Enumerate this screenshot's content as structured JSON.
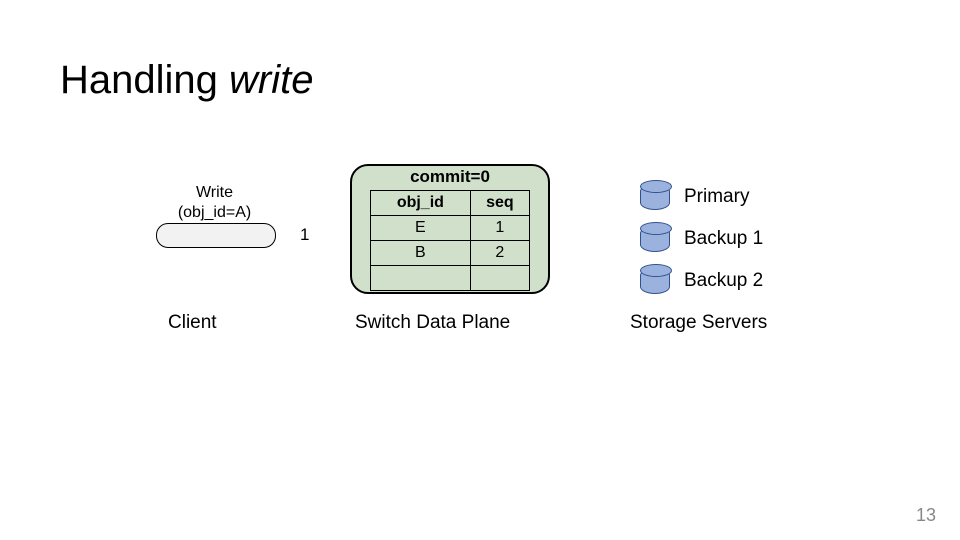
{
  "title_prefix": "Handling ",
  "title_italic": "write",
  "write": {
    "line1": "Write",
    "line2": "(obj_id=A)"
  },
  "packet_number": "1",
  "client_label": "Client",
  "switch": {
    "commit": "commit=0",
    "headers": {
      "obj_id": "obj_id",
      "seq": "seq"
    },
    "rows": [
      {
        "obj_id": "E",
        "seq": "1"
      },
      {
        "obj_id": "B",
        "seq": "2"
      },
      {
        "obj_id": "",
        "seq": ""
      }
    ],
    "label": "Switch Data Plane"
  },
  "servers": {
    "primary": "Primary",
    "backup1": "Backup 1",
    "backup2": "Backup 2",
    "label": "Storage Servers"
  },
  "page_number": "13"
}
